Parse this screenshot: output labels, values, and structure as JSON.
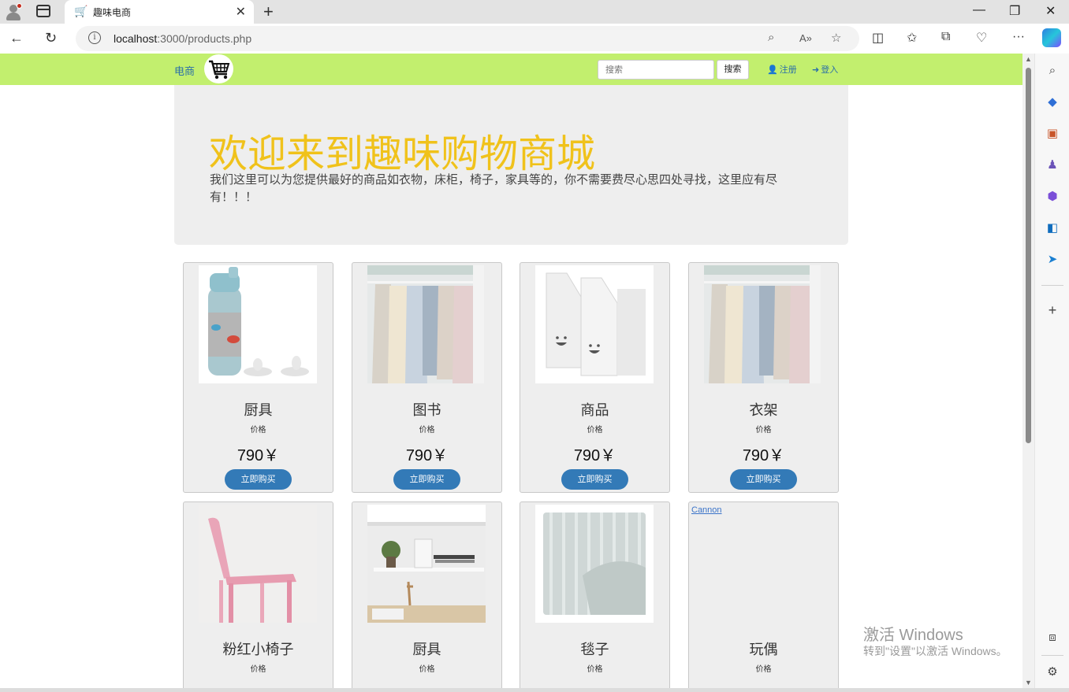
{
  "browser": {
    "tab_title": "趣味电商",
    "url_host": "localhost",
    "url_rest": ":3000/products.php"
  },
  "site": {
    "brand": "电商",
    "search_placeholder": "搜索",
    "search_button": "搜索",
    "register": "注册",
    "login": "登入"
  },
  "hero": {
    "title": "欢迎来到趣味购物商城",
    "text": "我们这里可以为您提供最好的商品如衣物，床柜，椅子，家具等的，你不需要费尽心思四处寻找，这里应有尽有！！！"
  },
  "products": [
    {
      "name": "厨具",
      "price_label": "价格",
      "price": "790￥",
      "buy": "立即购买",
      "image": "thermos"
    },
    {
      "name": "图书",
      "price_label": "价格",
      "price": "790￥",
      "buy": "立即购买",
      "image": "clothes"
    },
    {
      "name": "商品",
      "price_label": "价格",
      "price": "790￥",
      "buy": "立即购买",
      "image": "magazine-files"
    },
    {
      "name": "衣架",
      "price_label": "价格",
      "price": "790￥",
      "buy": "立即购买",
      "image": "clothes"
    },
    {
      "name": "粉红小椅子",
      "price_label": "价格",
      "image": "pink-chair"
    },
    {
      "name": "厨具",
      "price_label": "价格",
      "image": "shelves"
    },
    {
      "name": "毯子",
      "price_label": "价格",
      "image": "blanket"
    },
    {
      "name": "玩偶",
      "price_label": "价格",
      "image": "broken",
      "alt": "Cannon"
    }
  ],
  "watermark": {
    "line1": "激活 Windows",
    "line2": "转到\"设置\"以激活 Windows。"
  },
  "colors": {
    "navbar": "#c2ef6e",
    "hero_title": "#f0c21b",
    "button": "#337ab7",
    "card_bg": "#eeeeee"
  }
}
